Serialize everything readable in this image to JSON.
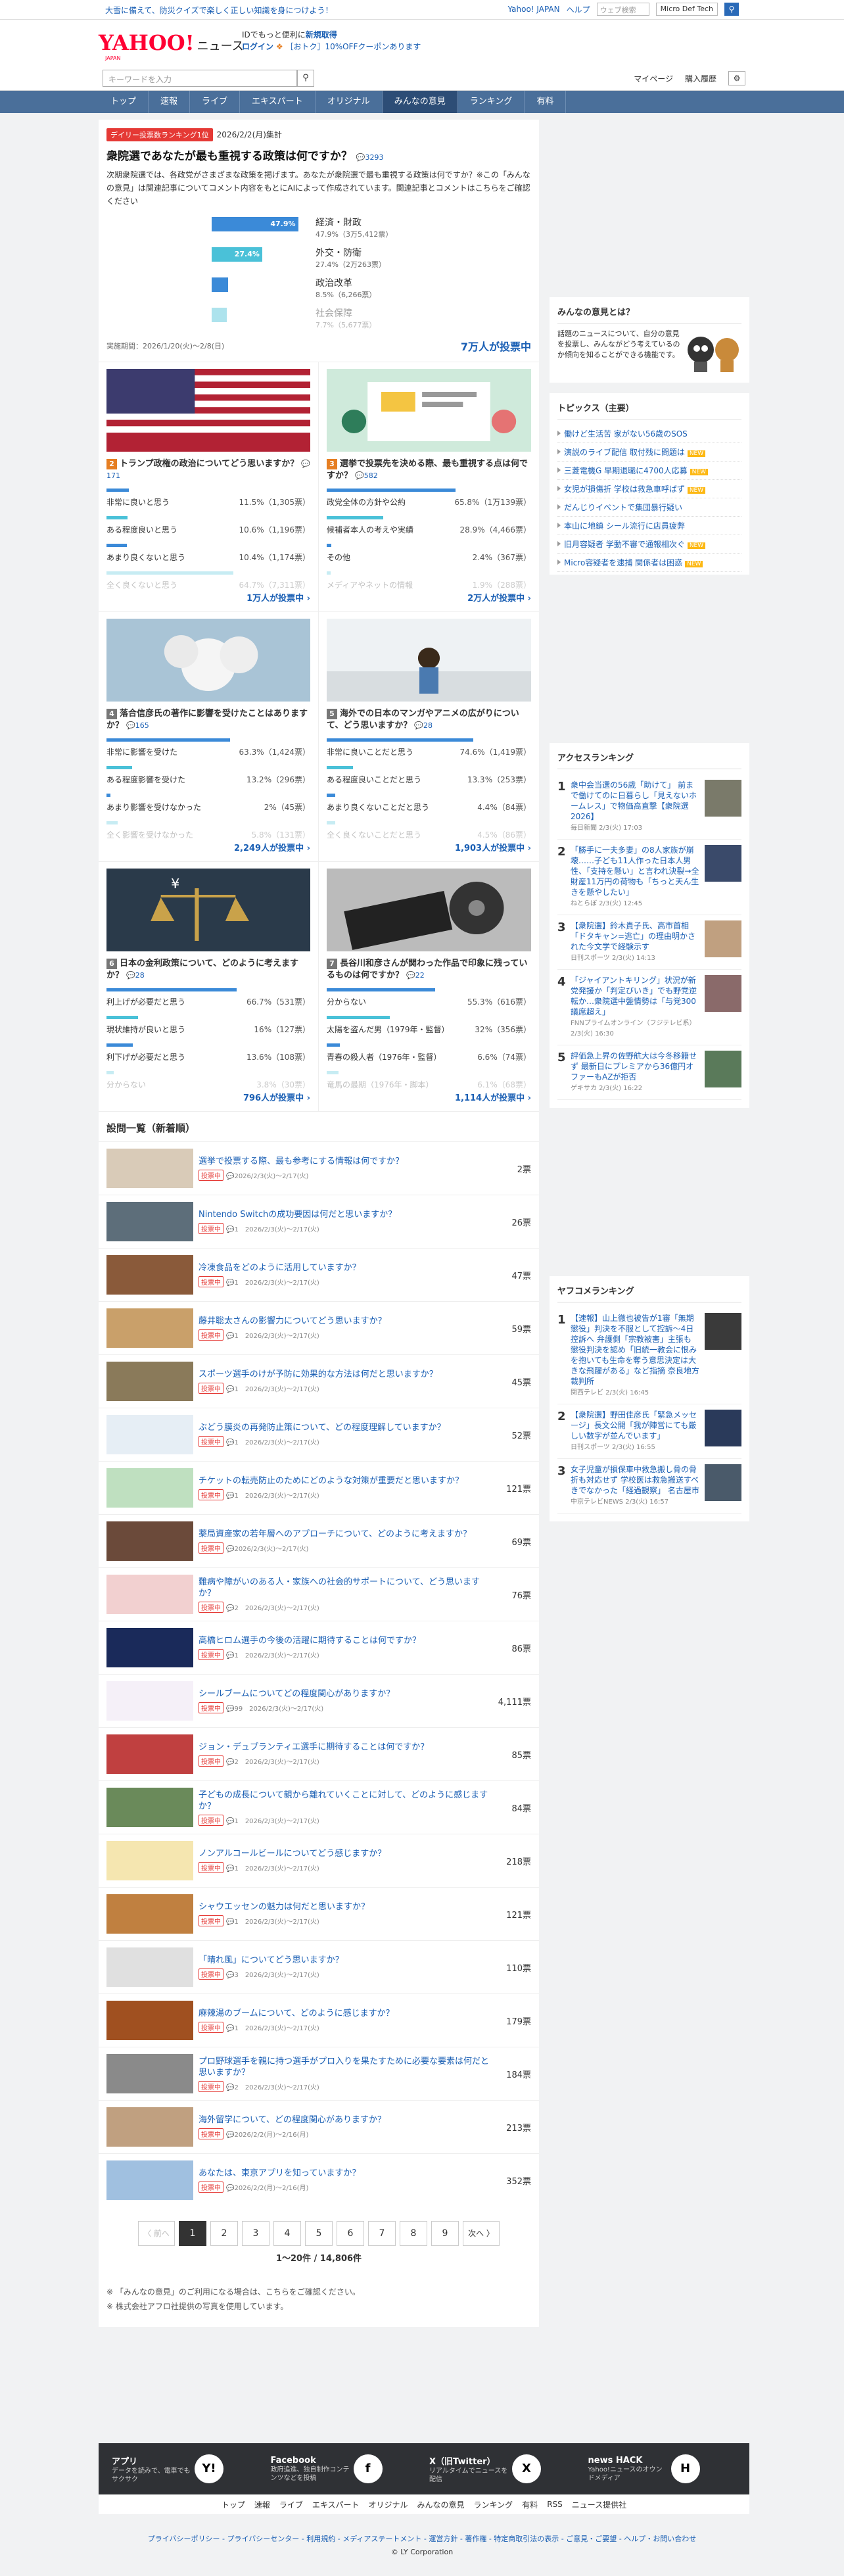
{
  "topbar": {
    "promo": "大雪に備えて、防災クイズで楽しく正しい知識を身につけよう！",
    "links": [
      "Yahoo! JAPAN",
      "ヘルプ"
    ],
    "search_placeholder": "ウェブ検索",
    "search_sponsor": "Micro Def Tech"
  },
  "header": {
    "logo": "YAHOO!",
    "logo_section": "ニュース",
    "logo_sub": "JAPAN",
    "login_line1_pre": "IDでもっと便利に",
    "login_line1_link": "新規取得",
    "login_line2_link": "ログイン",
    "login_line2_text": "［おトク］10%OFFクーポンあります"
  },
  "search": {
    "placeholder": "キーワードを入力",
    "links": [
      "マイページ",
      "購入履歴"
    ]
  },
  "nav": [
    "トップ",
    "速報",
    "ライブ",
    "エキスパート",
    "オリジナル",
    "みんなの意見",
    "ランキング",
    "有料"
  ],
  "hero": {
    "badge": "デイリー投票数ランキング1位",
    "date": "2026/2/2(月)集計",
    "title": "衆院選であなたが最も重視する政策は何ですか？",
    "comments": "3293",
    "body": "次期衆院選では、各政党がさまざまな政策を掲げます。あなたが衆院選で最も重視する政策は何ですか？※この「みんなの意見」は関連記事についてコメント内容をもとにAIによって作成されています。関連記事とコメントはこちらをご確認ください",
    "options": [
      {
        "label": "経済・財政",
        "pct": 47.9,
        "pct_text": "47.9%",
        "detail": "47.9%（3万5,412票）"
      },
      {
        "label": "外交・防衛",
        "pct": 27.4,
        "pct_text": "27.4%",
        "detail": "27.4%（2万263票）"
      },
      {
        "label": "政治改革",
        "pct": 8.5,
        "pct_text": "",
        "detail": "8.5%（6,266票）"
      },
      {
        "label": "社会保障",
        "pct": 7.7,
        "pct_text": "",
        "detail": "7.7%（5,677票）"
      }
    ],
    "period": "実施期間：2026/1/20(火)〜2/8(日)",
    "votes": "7万人が投票中"
  },
  "cards": [
    {
      "num": "2",
      "title": "トランプ政権の政治についてどう思いますか？",
      "comments": "171",
      "votes": "1万人が投票中",
      "options": [
        {
          "label": "非常に良いと思う",
          "pct": 11.5,
          "value": "11.5%（1,305票）"
        },
        {
          "label": "ある程度良いと思う",
          "pct": 10.6,
          "value": "10.6%（1,196票）"
        },
        {
          "label": "あまり良くないと思う",
          "pct": 10.4,
          "value": "10.4%（1,174票）"
        },
        {
          "label": "全く良くないと思う",
          "pct": 64.7,
          "value": "64.7%（7,311票）"
        }
      ]
    },
    {
      "num": "3",
      "title": "選挙で投票先を決める際、最も重視する点は何ですか？",
      "comments": "582",
      "votes": "2万人が投票中",
      "options": [
        {
          "label": "政党全体の方針や公約",
          "pct": 65.8,
          "value": "65.8%（1万139票）"
        },
        {
          "label": "候補者本人の考えや実績",
          "pct": 28.9,
          "value": "28.9%（4,466票）"
        },
        {
          "label": "その他",
          "pct": 2.4,
          "value": "2.4%（367票）"
        },
        {
          "label": "メディアやネットの情報",
          "pct": 1.9,
          "value": "1.9%（288票）"
        }
      ]
    },
    {
      "num": "4",
      "title": "落合信彦氏の著作に影響を受けたことはありますか？",
      "comments": "165",
      "votes": "2,249人が投票中",
      "options": [
        {
          "label": "非常に影響を受けた",
          "pct": 63.3,
          "value": "63.3%（1,424票）"
        },
        {
          "label": "ある程度影響を受けた",
          "pct": 13.2,
          "value": "13.2%（296票）"
        },
        {
          "label": "あまり影響を受けなかった",
          "pct": 2,
          "value": "2%（45票）"
        },
        {
          "label": "全く影響を受けなかった",
          "pct": 5.8,
          "value": "5.8%（131票）"
        }
      ]
    },
    {
      "num": "5",
      "title": "海外での日本のマンガやアニメの広がりについて、どう思いますか？",
      "comments": "28",
      "votes": "1,903人が投票中",
      "options": [
        {
          "label": "非常に良いことだと思う",
          "pct": 74.6,
          "value": "74.6%（1,419票）"
        },
        {
          "label": "ある程度良いことだと思う",
          "pct": 13.3,
          "value": "13.3%（253票）"
        },
        {
          "label": "あまり良くないことだと思う",
          "pct": 4.4,
          "value": "4.4%（84票）"
        },
        {
          "label": "全く良くないことだと思う",
          "pct": 4.5,
          "value": "4.5%（86票）"
        }
      ]
    },
    {
      "num": "6",
      "title": "日本の金利政策について、どのように考えますか？",
      "comments": "28",
      "votes": "796人が投票中",
      "options": [
        {
          "label": "利上げが必要だと思う",
          "pct": 66.7,
          "value": "66.7%（531票）"
        },
        {
          "label": "現状維持が良いと思う",
          "pct": 16,
          "value": "16%（127票）"
        },
        {
          "label": "利下げが必要だと思う",
          "pct": 13.6,
          "value": "13.6%（108票）"
        },
        {
          "label": "分からない",
          "pct": 3.8,
          "value": "3.8%（30票）"
        }
      ]
    },
    {
      "num": "7",
      "title": "長谷川和彦さんが関わった作品で印象に残っているものは何ですか？",
      "comments": "22",
      "votes": "1,114人が投票中",
      "options": [
        {
          "label": "分からない",
          "pct": 55.3,
          "value": "55.3%（616票）"
        },
        {
          "label": "太陽を盗んだ男（1979年・監督）",
          "pct": 32,
          "value": "32%（356票）"
        },
        {
          "label": "青春の殺人者（1976年・監督）",
          "pct": 6.6,
          "value": "6.6%（74票）"
        },
        {
          "label": "竜馬の最期（1976年・脚本）",
          "pct": 6.1,
          "value": "6.1%（68票）"
        }
      ]
    }
  ],
  "list": {
    "heading": "設問一覧（新着順）",
    "tag": "投票中",
    "items": [
      {
        "title": "選挙で投票する際、最も参考にする情報は何ですか？",
        "meta": "2026/2/3(火)〜2/17(火)",
        "votes": "2票",
        "color": "#d9cbb8"
      },
      {
        "title": "Nintendo Switchの成功要因は何だと思いますか？",
        "meta": "1　2026/2/3(火)〜2/17(火)",
        "votes": "26票",
        "color": "#5d6e7a"
      },
      {
        "title": "冷凍食品をどのように活用していますか？",
        "meta": "1　2026/2/3(火)〜2/17(火)",
        "votes": "47票",
        "color": "#8a5a3a"
      },
      {
        "title": "藤井聡太さんの影響力についてどう思いますか？",
        "meta": "1　2026/2/3(火)〜2/17(火)",
        "votes": "59票",
        "color": "#c9a06a"
      },
      {
        "title": "スポーツ選手のけが予防に効果的な方法は何だと思いますか？",
        "meta": "1　2026/2/3(火)〜2/17(火)",
        "votes": "45票",
        "color": "#8a7a5a"
      },
      {
        "title": "ぶどう膜炎の再発防止策について、どの程度理解していますか？",
        "meta": "1　2026/2/3(火)〜2/17(火)",
        "votes": "52票",
        "color": "#e6eef5"
      },
      {
        "title": "チケットの転売防止のためにどのような対策が重要だと思いますか？",
        "meta": "1　2026/2/3(火)〜2/17(火)",
        "votes": "121票",
        "color": "#bfe0c0"
      },
      {
        "title": "薬局資産家の若年層へのアプローチについて、どのように考えますか？",
        "meta": "2026/2/3(火)〜2/17(火)",
        "votes": "69票",
        "color": "#6b4a3a"
      },
      {
        "title": "難病や障がいのある人・家族への社会的サポートについて、どう思いますか？",
        "meta": "2　2026/2/3(火)〜2/17(火)",
        "votes": "76票",
        "color": "#f2d0d0"
      },
      {
        "title": "高橋ヒロム選手の今後の活躍に期待することは何ですか？",
        "meta": "1　2026/2/3(火)〜2/17(火)",
        "votes": "86票",
        "color": "#1a2a5a"
      },
      {
        "title": "シールブームについてどの程度関心がありますか？",
        "meta": "99　2026/2/3(火)〜2/17(火)",
        "votes": "4,111票",
        "color": "#f5f0f8"
      },
      {
        "title": "ジョン・デュプランティエ選手に期待することは何ですか？",
        "meta": "2　2026/2/3(火)〜2/17(火)",
        "votes": "85票",
        "color": "#c04040"
      },
      {
        "title": "子どもの成長について親から離れていくことに対して、どのように感じますか？",
        "meta": "1　2026/2/3(火)〜2/17(火)",
        "votes": "84票",
        "color": "#6a8a5a"
      },
      {
        "title": "ノンアルコールビールについてどう感じますか？",
        "meta": "1　2026/2/3(火)〜2/17(火)",
        "votes": "218票",
        "color": "#f5e6b0"
      },
      {
        "title": "シャウエッセンの魅力は何だと思いますか？",
        "meta": "1　2026/2/3(火)〜2/17(火)",
        "votes": "121票",
        "color": "#c08040"
      },
      {
        "title": "「晴れ風」についてどう思いますか？",
        "meta": "3　2026/2/3(火)〜2/17(火)",
        "votes": "110票",
        "color": "#e0e0e0"
      },
      {
        "title": "麻辣湯のブームについて、どのように感じますか？",
        "meta": "1　2026/2/3(火)〜2/17(火)",
        "votes": "179票",
        "color": "#a05020"
      },
      {
        "title": "プロ野球選手を親に持つ選手がプロ入りを果たすために必要な要素は何だと思いますか？",
        "meta": "2　2026/2/3(火)〜2/17(火)",
        "votes": "184票",
        "color": "#8a8a8a"
      },
      {
        "title": "海外留学について、どの程度関心がありますか？",
        "meta": "2026/2/2(月)〜2/16(月)",
        "votes": "213票",
        "color": "#c0a080"
      },
      {
        "title": "あなたは、東京アプリを知っていますか？",
        "meta": "2026/2/2(月)〜2/16(月)",
        "votes": "352票",
        "color": "#a0c0e0"
      }
    ]
  },
  "pager": {
    "prev": "〈 前へ",
    "pages": [
      "1",
      "2",
      "3",
      "4",
      "5",
      "6",
      "7",
      "8",
      "9"
    ],
    "next": "次へ 〉",
    "count": "1〜20件 / 14,806件"
  },
  "notes": [
    "「みんなの意見」のご利用になる場合は、こちらをご確認ください。",
    "株式会社アフロ社提供の写真を使用しています。"
  ],
  "side": {
    "about_title": "みんなの意見とは？",
    "about_text": "話題のニュースについて、自分の意見を投票し、みんながどう考えているのか傾向を知ることができる機能です。",
    "topics_title": "トピックス（主要）",
    "topics": [
      {
        "t": "働けど生活苦 家がない56歳のSOS",
        "n": false
      },
      {
        "t": "演説のライブ配信 取付残に問題は",
        "n": true
      },
      {
        "t": "三菱電機G 早期退職に4700人応募",
        "n": true
      },
      {
        "t": "女児が損傷折 学校は救急車呼ばず",
        "n": true
      },
      {
        "t": "だんじりイベントで集団暴行疑い",
        "n": false
      },
      {
        "t": "本山に地鎮 シール流行に店員疲弊",
        "n": false
      },
      {
        "t": "旧月容疑者 学動不審で通報相次ぐ",
        "n": true
      },
      {
        "t": "Micro容疑者を逮捕 関係者は困惑",
        "n": true
      }
    ],
    "access_title": "アクセスランキング",
    "access": [
      {
        "t": "衆中会当選の56歳「助けて」 前まで働けてのに日暮らし「見えないホームレス」で物価高直撃【衆院選2026】",
        "m": "毎日新聞 2/3(火) 17:03",
        "c": "#7a7a6a"
      },
      {
        "t": "「勝手に一夫多妻」の8人家族が崩壊……子ども11人作った日本人男性、「支持を懸い」と言われ決裂→全財産11万円の荷物も「ちっと天ん生きを懸やしたい」",
        "m": "ねとらぼ 2/3(火) 12:45",
        "c": "#3a4a6a"
      },
      {
        "t": "【衆院選】鈴木貴子氏、高市首相「ドタキャン=逃亡」の理由明かされた今文学で経験示す",
        "m": "日刊スポーツ 2/3(火) 14:13",
        "c": "#c0a080"
      },
      {
        "t": "「ジャイアントキリング」状況が新党発援か「判定びいき」でも野党逆転か…衆院選中盤情勢は「与党300議席超え」",
        "m": "FNNプライムオンライン（フジテレビ系） 2/3(火) 16:30",
        "c": "#8a6a6a"
      },
      {
        "t": "評価急上昇の佐野航大は今冬移籍せず 最新日にプレミアから36億円オファーもAZが拒否",
        "m": "ゲキサカ 2/3(火) 16:22",
        "c": "#5a7a5a"
      }
    ],
    "yahoo_title": "ヤフコメランキング",
    "yahoo": [
      {
        "t": "【速報】山上徹也被告が1審「無期懲役」判決を不服として控訴〜4日控訴へ 弁護側「宗教被害」主張も 懲役判決を認め「旧統一教会に恨みを抱いても生命を奪う意思決定は大きな飛躍がある」など指摘 奈良地方裁判所",
        "m": "関西テレビ 2/3(火) 16:45",
        "c": "#3a3a3a"
      },
      {
        "t": "【衆院選】野田佳彦氏「緊急メッセージ」長文公開「我が陣営にても厳しい数字が並んでいます」",
        "m": "日刊スポーツ 2/3(火) 16:55",
        "c": "#2a3a5a"
      },
      {
        "t": "女子児童が損保車中救急搬し骨の骨折も対応せず 学校医は救急搬送すべきでなかった「経過観察」 名古屋市",
        "m": "中京テレビNEWS 2/3(火) 16:57",
        "c": "#4a5a6a"
      }
    ]
  },
  "footer": {
    "apps": [
      {
        "title": "アプリ",
        "desc": "データを読みで、電車でもサクサク",
        "icon": "Y!"
      },
      {
        "title": "Facebook",
        "desc": "政府追進、独自制作コンテンツなどを投稿",
        "icon": "f"
      },
      {
        "title": "X（旧Twitter）",
        "desc": "リアルタイムでニュースを配信",
        "icon": "X"
      },
      {
        "title": "news HACK",
        "desc": "Yahoo!ニュースのオウンドメディア",
        "icon": "H"
      }
    ],
    "links": [
      "トップ",
      "速報",
      "ライブ",
      "エキスパート",
      "オリジナル",
      "みんなの意見",
      "ランキング",
      "有料",
      "RSS",
      "ニュース提供社"
    ],
    "bottom": "プライバシーポリシー - プライバシーセンター - 利用規約 - メディアステートメント - 運営方針 - 著作権 - 特定商取引法の表示 - ご意見・ご要望 - ヘルプ・お問い合わせ",
    "copyright": "© LY Corporation"
  }
}
